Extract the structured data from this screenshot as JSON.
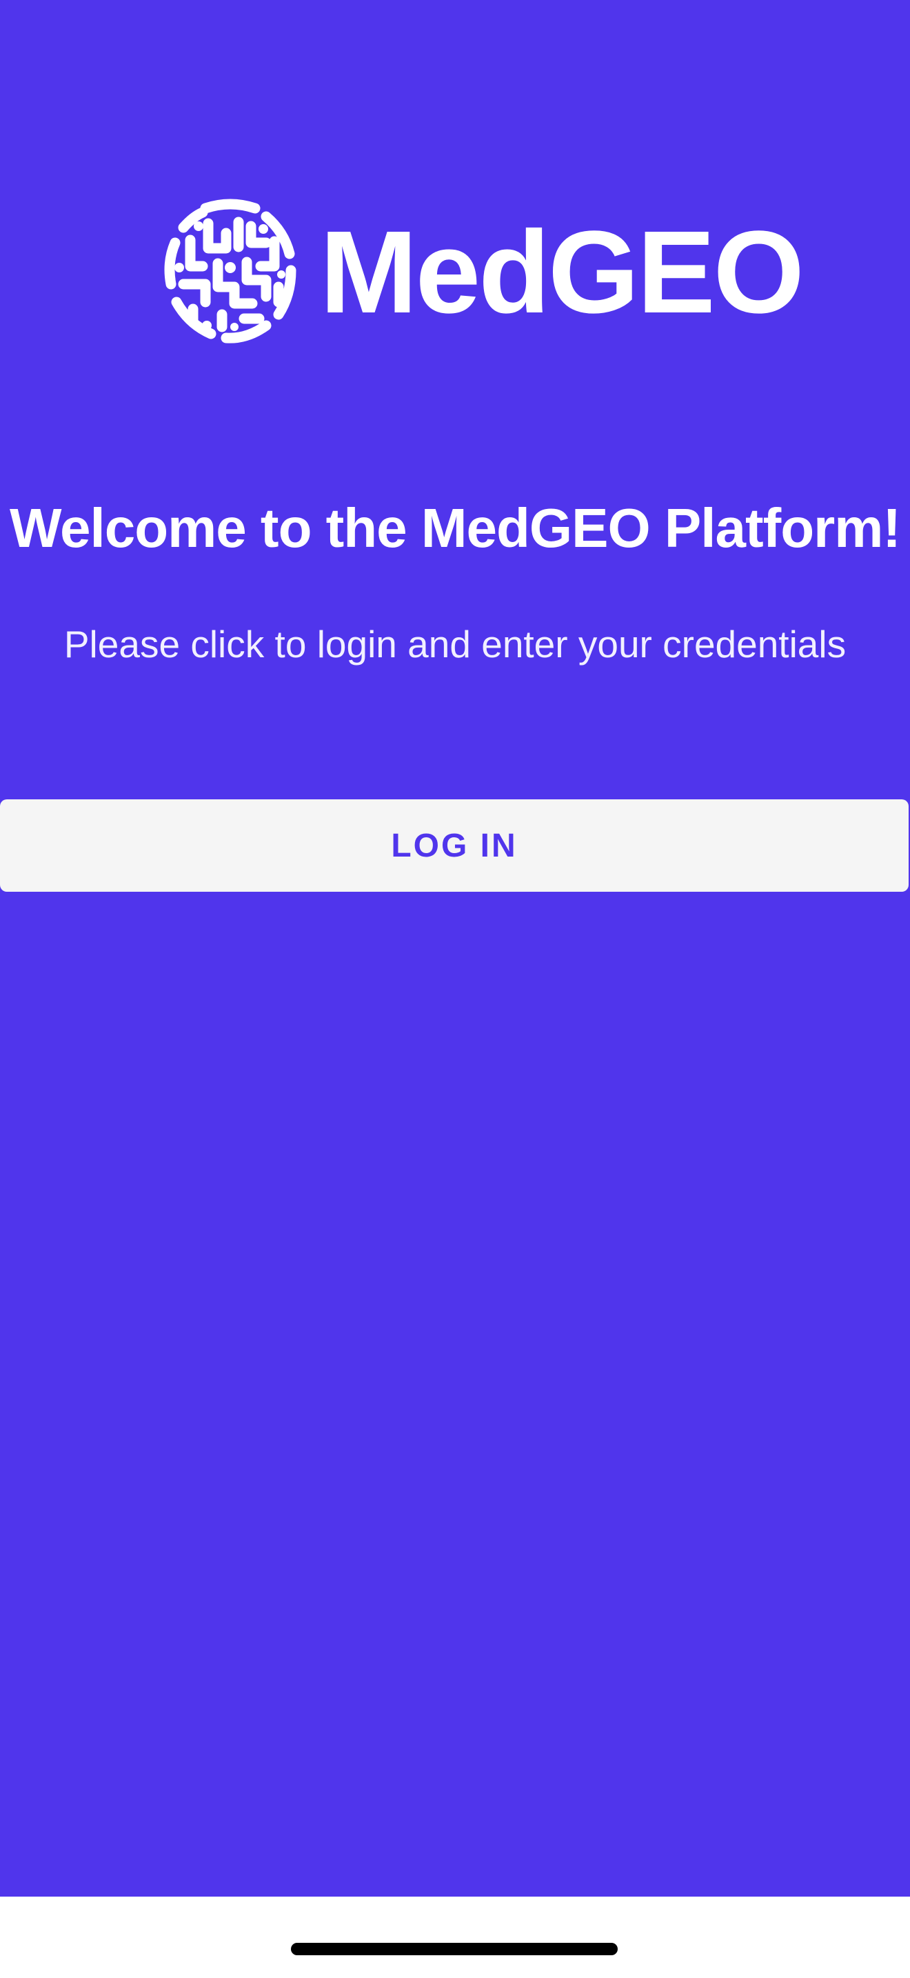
{
  "app": {
    "brand_name": "MedGEO",
    "background_color": "#5035EC",
    "accent_color": "#5035EC"
  },
  "welcome": {
    "title": "Welcome to the MedGEO Platform!",
    "subtitle": "Please click to login and enter your credentials"
  },
  "actions": {
    "login_label": "LOG IN"
  },
  "icons": {
    "logo": "brain-globe-logo-icon"
  }
}
